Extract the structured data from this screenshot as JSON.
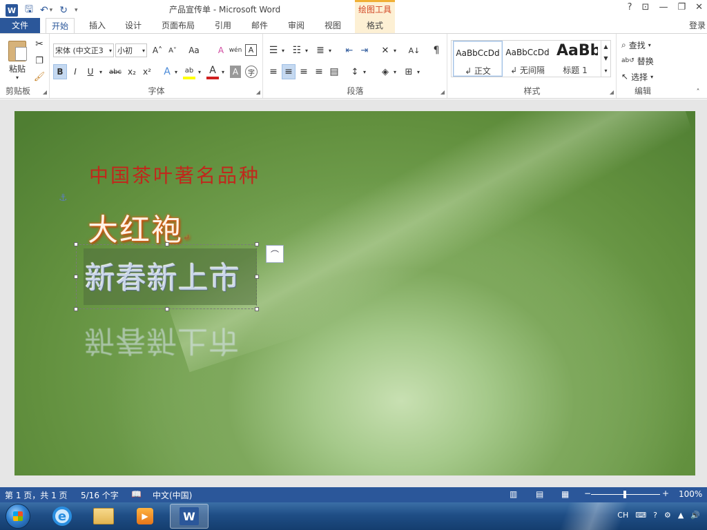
{
  "titlebar": {
    "doc_title": "产品宣传单 - Microsoft Word",
    "context_tab_header": "绘图工具",
    "app_icon": "W",
    "help": "?",
    "ribbon_display": "⊡",
    "minimize": "—",
    "restore": "❐",
    "close": "✕"
  },
  "tabs": {
    "file": "文件",
    "items": [
      "开始",
      "插入",
      "设计",
      "页面布局",
      "引用",
      "邮件",
      "审阅",
      "视图",
      "格式"
    ],
    "login": "登录"
  },
  "ribbon": {
    "clipboard": {
      "label": "剪贴板",
      "paste": "粘贴"
    },
    "font": {
      "label": "字体",
      "font_name": "宋体 (中文正3",
      "font_size": "小初",
      "grow": "A˄",
      "shrink": "A˅",
      "change_case": "Aa",
      "clear": "A",
      "phonetic": "wén",
      "border_char": "A",
      "bold": "B",
      "italic": "I",
      "underline": "U",
      "strike": "abc",
      "subscript": "x₂",
      "superscript": "x²",
      "effects": "A",
      "highlight": "ab",
      "font_color": "A",
      "shading": "A",
      "enclose": "字"
    },
    "paragraph": {
      "label": "段落"
    },
    "styles": {
      "label": "样式",
      "items": [
        {
          "sample": "AaBbCcDd",
          "name": "↲ 正文"
        },
        {
          "sample": "AaBbCcDd",
          "name": "↲ 无间隔"
        },
        {
          "sample": "AaBb",
          "name": "标题 1"
        }
      ]
    },
    "editing": {
      "label": "编辑",
      "find": "查找",
      "replace": "替换",
      "select": "选择"
    }
  },
  "document": {
    "heading": "中国茶叶著名品种",
    "product": "大红袍",
    "textbox_text": "新春新上市",
    "paragraph_mark": "↵"
  },
  "statusbar": {
    "page": "第 1 页，共 1 页",
    "words": "5/16 个字",
    "language": "中文(中国)",
    "zoom_out": "−",
    "zoom_in": "+",
    "zoom": "100%"
  },
  "taskbar": {
    "ime": "CH",
    "colors": {
      "accent": "#2b579a",
      "title_red": "#c0281c",
      "orange_glow": "#e8671d"
    }
  }
}
